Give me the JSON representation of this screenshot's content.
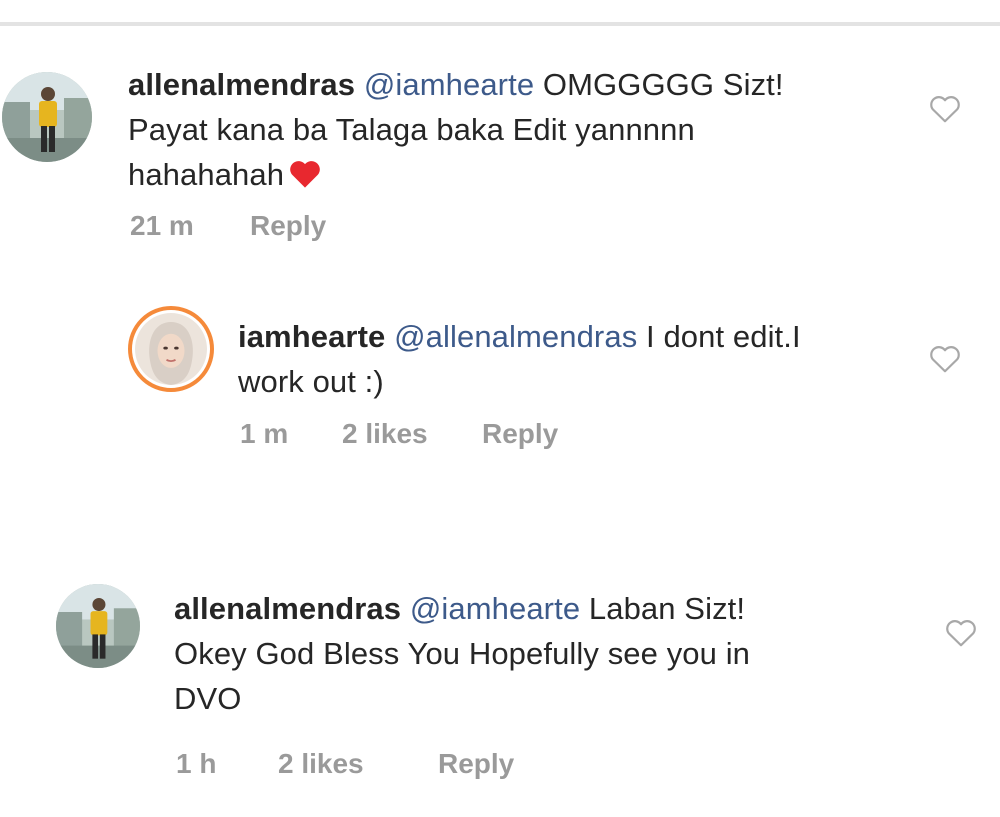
{
  "comments": [
    {
      "username": "allenalmendras",
      "mention": "@iamhearte",
      "line1_rest": "OMGGGGG Sizt!",
      "line2": "Payat kana ba Talaga baka Edit yannnnn",
      "line3": "hahahahah",
      "emoji": "red-heart-emoji",
      "time": "21 m",
      "reply_label": "Reply"
    },
    {
      "username": "iamhearte",
      "mention": "@allenalmendras",
      "line1_rest": "I dont edit.I",
      "line2": "work out :)",
      "time": "1 m",
      "likes": "2 likes",
      "reply_label": "Reply"
    },
    {
      "username": "allenalmendras",
      "mention": "@iamhearte",
      "line1_rest": "Laban Sizt!",
      "line2": "Okey God Bless You Hopefully see you in",
      "line3": "DVO",
      "time": "1 h",
      "likes": "2 likes",
      "reply_label": "Reply"
    }
  ],
  "colors": {
    "text": "#262626",
    "mention": "#3d5a8a",
    "meta": "#9a9a9a",
    "heart": "#e8282f",
    "story_ring": "#f58a3a"
  },
  "icons": [
    "heart-outline-icon",
    "red-heart-emoji"
  ]
}
